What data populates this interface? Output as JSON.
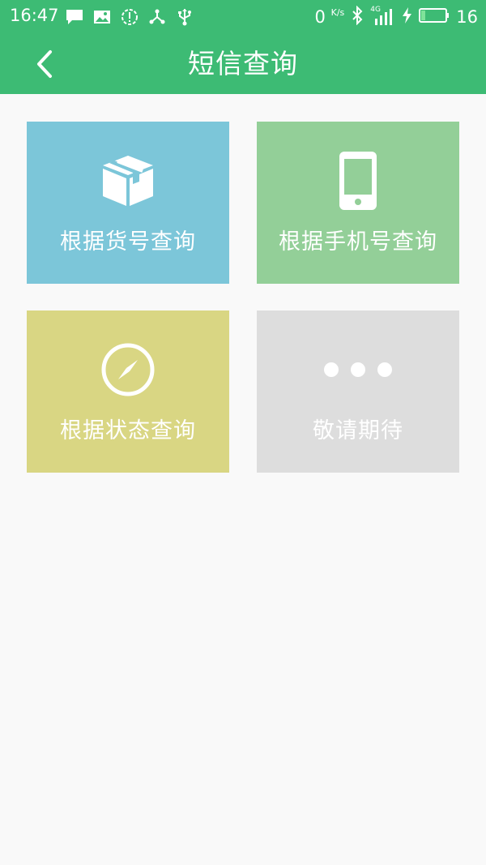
{
  "status_bar": {
    "time": "16:47",
    "speed_value": "0",
    "speed_unit": "K/s",
    "network": "4G",
    "battery": "16",
    "icons": [
      "message-icon",
      "image-icon",
      "alert-icon",
      "share-icon",
      "usb-icon",
      "bluetooth-icon",
      "signal-icon",
      "charging-icon",
      "battery-icon"
    ]
  },
  "header": {
    "title": "短信查询",
    "back_icon": "chevron-left-icon"
  },
  "tiles": [
    {
      "label": "根据货号查询",
      "icon": "package-icon",
      "color": "#7cc6d9"
    },
    {
      "label": "根据手机号查询",
      "icon": "phone-icon",
      "color": "#93cf98"
    },
    {
      "label": "根据状态查询",
      "icon": "compass-icon",
      "color": "#d9d683"
    },
    {
      "label": "敬请期待",
      "icon": "more-dots-icon",
      "color": "#dddddd"
    }
  ],
  "colors": {
    "primary": "#3dbb74",
    "background": "#f9f9f9"
  }
}
